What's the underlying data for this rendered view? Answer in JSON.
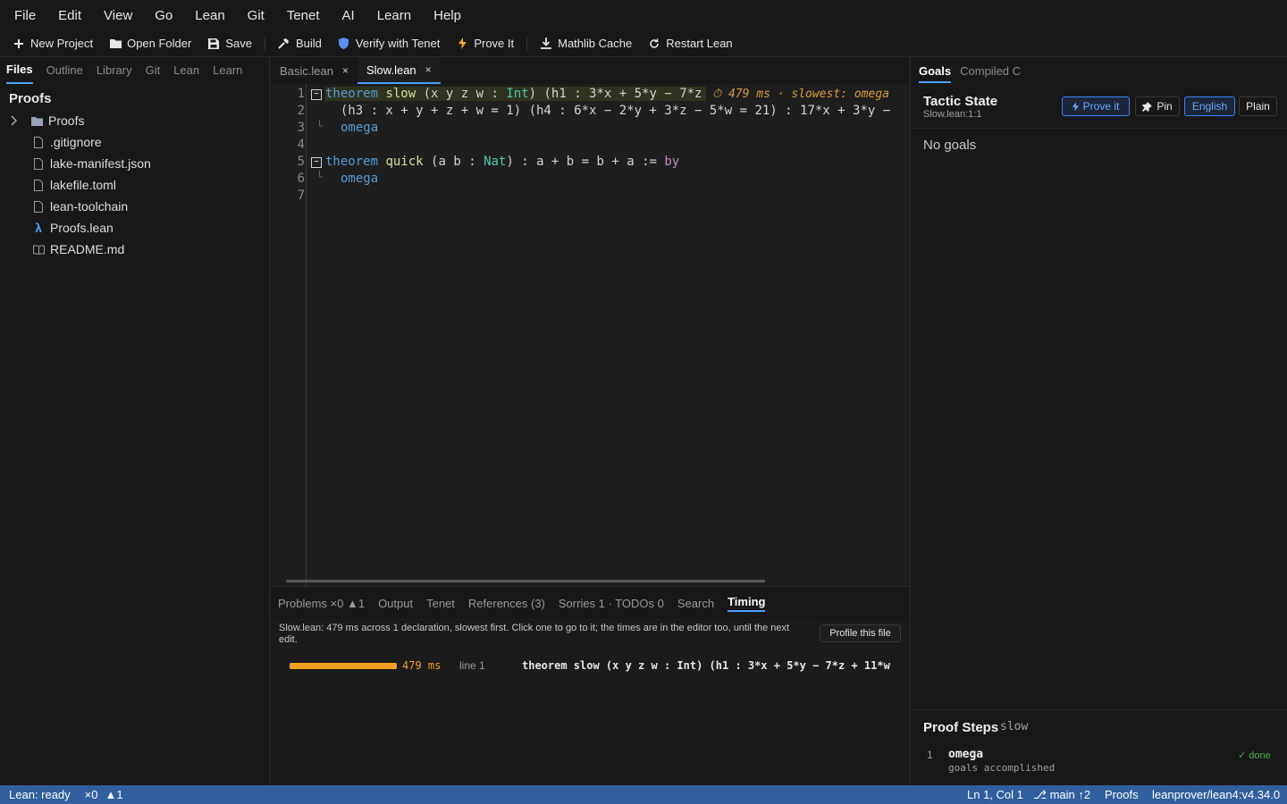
{
  "menubar": [
    "File",
    "Edit",
    "View",
    "Go",
    "Lean",
    "Git",
    "Tenet",
    "AI",
    "Learn",
    "Help"
  ],
  "toolbar": {
    "new_project": "New Project",
    "open_folder": "Open Folder",
    "save": "Save",
    "build": "Build",
    "verify": "Verify with Tenet",
    "prove": "Prove It",
    "mathlib": "Mathlib Cache",
    "restart": "Restart Lean"
  },
  "sidebar": {
    "tabs": [
      "Files",
      "Outline",
      "Library",
      "Git",
      "Lean",
      "Learn"
    ],
    "title": "Proofs",
    "tree": [
      {
        "name": "Proofs",
        "kind": "folder"
      },
      {
        "name": ".gitignore",
        "kind": "file"
      },
      {
        "name": "lake-manifest.json",
        "kind": "file"
      },
      {
        "name": "lakefile.toml",
        "kind": "file"
      },
      {
        "name": "lean-toolchain",
        "kind": "file"
      },
      {
        "name": "Proofs.lean",
        "kind": "lean"
      },
      {
        "name": "README.md",
        "kind": "book"
      }
    ]
  },
  "editor": {
    "tabs": [
      {
        "label": "Basic.lean",
        "close": "×"
      },
      {
        "label": "Slow.lean",
        "close": "×"
      }
    ],
    "line_numbers": [
      "1",
      "2",
      "3",
      "4",
      "5",
      "6",
      "7"
    ],
    "line1": {
      "kw": "theorem",
      "name": "slow",
      "a": "(x y z w : ",
      "ty": "Int",
      "b": ") (h1 : 3*x + 5*y − 7*z"
    },
    "line2": "(h3 : x + y + z + w = 1) (h4 : 6*x − 2*y + 3*z − 5*w = 21) : 17*x + 3*y −",
    "line3": "omega",
    "line5": {
      "kw": "theorem",
      "name": "quick",
      "a": "(a b : ",
      "ty": "Nat",
      "b": ") : a + b = b + a := ",
      "by": "by"
    },
    "line6": "omega",
    "inlay": "⏱ 479 ms  · slowest: omega"
  },
  "panel": {
    "tabs": [
      "Problems  ×0  ▲1",
      "Output",
      "Tenet",
      "References (3)",
      "Sorries 1 · TODOs 0",
      "Search",
      "Timing"
    ],
    "description": "Slow.lean: 479 ms across 1 declaration, slowest first. Click one to go to it; the times are in the editor too, until the next edit.",
    "profile_button": "Profile this file",
    "timing": {
      "ms_label": "479 ms",
      "line": "line 1",
      "code": "theorem slow (x y z w : Int) (h1 : 3*x + 5*y − 7*z + 11*w",
      "fraction": 1.0
    }
  },
  "right": {
    "tabs": [
      "Goals",
      "Compiled C"
    ],
    "title": "Tactic State",
    "location": "Slow.lean:1:1",
    "buttons": {
      "prove": "Prove it",
      "pin": "Pin",
      "english": "English",
      "plain": "Plain"
    },
    "goals": "No goals",
    "steps": {
      "title": "Proof Steps",
      "decl": "slow",
      "items": [
        {
          "num": "1",
          "tactic": "omega",
          "sub": "goals accomplished",
          "status": "✓ done"
        }
      ]
    }
  },
  "status": {
    "lean": "Lean: ready",
    "errors": "×0",
    "warnings": "▲1",
    "position": "Ln 1, Col 1",
    "branch": "⎇ main ↑2",
    "project": "Proofs",
    "toolchain": "leanprover/lean4:v4.34.0"
  },
  "colors": {
    "accent": "#4ea1ff",
    "statusbar": "#2f5f9e",
    "timing": "#f0a020",
    "done": "#4caf50"
  }
}
